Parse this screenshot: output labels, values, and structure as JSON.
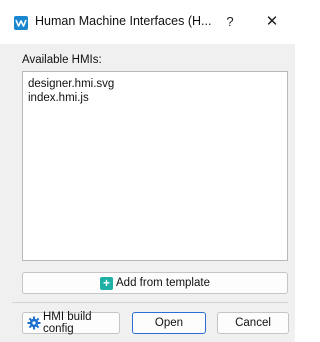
{
  "window": {
    "title": "Human Machine Interfaces (H...",
    "help_glyph": "?",
    "close_glyph": "✕"
  },
  "list_label": "Available HMIs:",
  "hmis": [
    "designer.hmi.svg",
    "index.hmi.js"
  ],
  "buttons": {
    "add_from_template": "Add from template",
    "hmi_build_config": "HMI build config",
    "open": "Open",
    "cancel": "Cancel"
  },
  "colors": {
    "accent": "#2b6fd6",
    "app_icon": "#1a86d0",
    "plus_icon": "#1fb0a5",
    "gear_icon": "#1f6fd0"
  },
  "icons": {
    "app": "app-logo-icon",
    "add": "plus-icon",
    "config": "gear-icon"
  }
}
